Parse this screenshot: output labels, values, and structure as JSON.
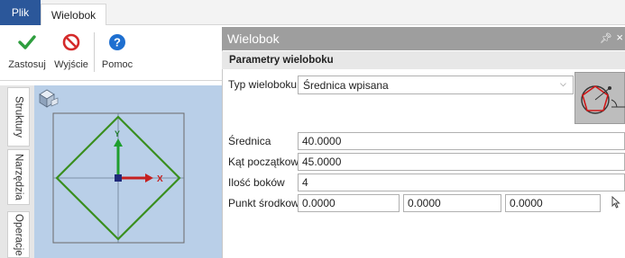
{
  "ribbon": {
    "tabs": [
      {
        "label": "Plik"
      },
      {
        "label": "Wielobok"
      }
    ],
    "buttons": {
      "apply": "Zastosuj",
      "exit": "Wyjście",
      "help": "Pomoc"
    }
  },
  "sidebar_tabs": [
    "Struktury",
    "Narzędzia",
    "Operacje"
  ],
  "viewport": {
    "axis_y": "Y",
    "axis_x": "X"
  },
  "panel": {
    "title": "Wielobok",
    "pin_icon": "pin-icon",
    "close_icon": "close-icon",
    "section": "Parametry wieloboku",
    "type_label": "Typ wieloboku",
    "type_value": "Średnica wpisana",
    "diameter_label": "Średnica",
    "diameter_value": "40.0000",
    "angle_label": "Kąt początkowy",
    "angle_value": "45.0000",
    "sides_label": "Ilość boków",
    "sides_value": "4",
    "center_label": "Punkt środkowy",
    "center_x": "0.0000",
    "center_y": "0.0000",
    "center_z": "0.0000"
  },
  "colors": {
    "accent": "#2b579a",
    "apply_green": "#2e9e3e",
    "exit_red": "#d42a2a",
    "help_blue": "#1e6fd0",
    "viewport_bg": "#b9cfe8",
    "polygon": "#3a8f1f"
  }
}
